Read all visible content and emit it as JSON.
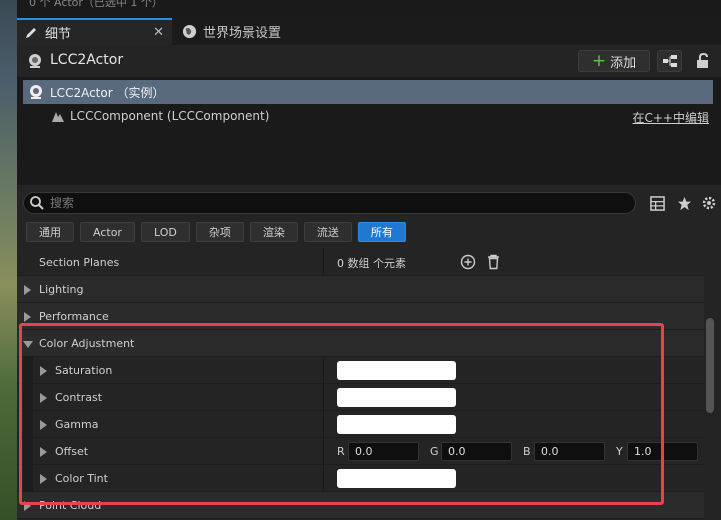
{
  "top_strip": {
    "text": "0 个 Actor（已选中 1 个）"
  },
  "tabs": [
    {
      "label": "细节",
      "active": true
    },
    {
      "label": "世界场景设置",
      "active": false
    }
  ],
  "header": {
    "title": "LCC2Actor",
    "add_label": "添加"
  },
  "tree": {
    "root_label": "LCC2Actor （实例）",
    "child_label": "LCCComponent (LCCComponent)",
    "edit_link": "在C++中编辑"
  },
  "search": {
    "placeholder": "搜索"
  },
  "filters": [
    "通用",
    "Actor",
    "LOD",
    "杂项",
    "渲染",
    "流送",
    "所有"
  ],
  "properties": {
    "section_planes": {
      "label": "Section Planes",
      "value": "0 数组 个元素"
    },
    "lighting": "Lighting",
    "performance": "Performance",
    "color_adjustment": "Color Adjustment",
    "saturation": "Saturation",
    "contrast": "Contrast",
    "gamma": "Gamma",
    "offset": {
      "label": "Offset",
      "r_label": "R",
      "r": "0.0",
      "g_label": "G",
      "g": "0.0",
      "b_label": "B",
      "b": "0.0",
      "y_label": "Y",
      "y": "1.0"
    },
    "color_tint": "Color Tint",
    "point_cloud": "Point Cloud"
  },
  "colors": {
    "accent": "#1f78d1",
    "highlight": "#e5444a",
    "add_green": "#5ec04a"
  }
}
